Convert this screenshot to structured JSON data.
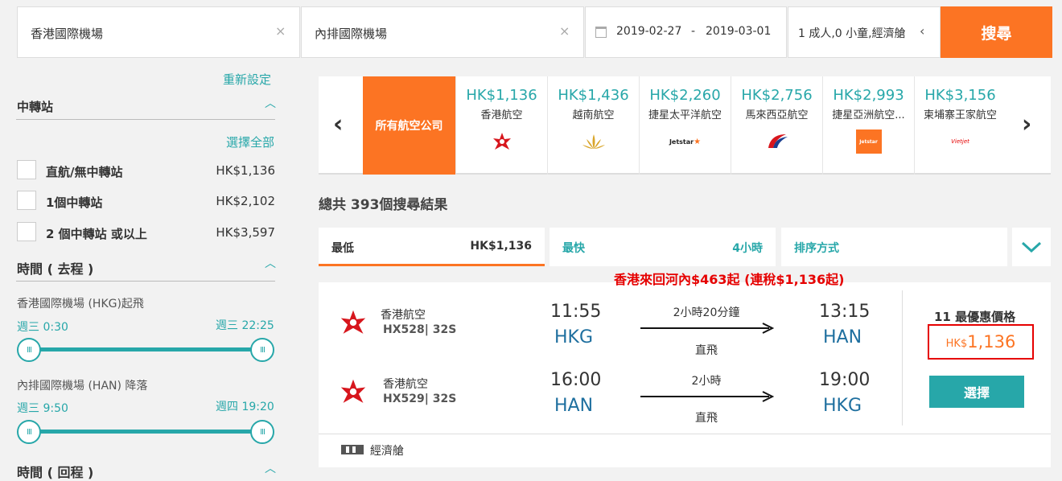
{
  "search": {
    "origin": "香港國際機場",
    "destination": "內排國際機場",
    "depart_date": "2019-02-27",
    "date_separator": "-",
    "return_date": "2019-03-01",
    "passengers": "1 成人,0 小童,經濟艙",
    "search_label": "搜尋"
  },
  "filters": {
    "reset_label": "重新設定",
    "transit_title": "中轉站",
    "select_all": "選擇全部",
    "stops": [
      {
        "label": "直航/無中轉站",
        "price": "HK$1,136"
      },
      {
        "label": "1個中轉站",
        "price": "HK$2,102"
      },
      {
        "label": "2 個中轉站 或以上",
        "price": "HK$3,597"
      }
    ],
    "outbound_title": "時間 ( 去程 )",
    "depart_label": "香港國際機場 (HKG)起飛",
    "depart_min": "週三 0:30",
    "depart_max": "週三 22:25",
    "arrive_label": "內排國際機場 (HAN) 降落",
    "arrive_min": "週三 9:50",
    "arrive_max": "週四 19:20",
    "return_title": "時間 ( 回程 )"
  },
  "airlines": {
    "all_label": "所有航空公司",
    "items": [
      {
        "price": "HK$1,136",
        "name": "香港航空"
      },
      {
        "price": "HK$1,436",
        "name": "越南航空"
      },
      {
        "price": "HK$2,260",
        "name": "捷星太平洋航空",
        "logo_text": "Jetstar"
      },
      {
        "price": "HK$2,756",
        "name": "馬來西亞航空"
      },
      {
        "price": "HK$2,993",
        "name": "捷星亞洲航空...",
        "logo_text": "Jetstar"
      },
      {
        "price": "HK$3,156",
        "name": "柬埔寨王家航空",
        "logo_text": "Vietjet"
      }
    ]
  },
  "results": {
    "total": "總共 393個搜尋結果",
    "sort_tabs": [
      {
        "label": "最低",
        "value": "HK$1,136"
      },
      {
        "label": "最快",
        "value": "4小時"
      },
      {
        "label": "排序方式",
        "value": ""
      }
    ],
    "promo": "香港來回河內$463起 (連稅$1,136起)",
    "outbound": {
      "airline": "香港航空",
      "code": "HX528| 32S",
      "dep_time": "11:55",
      "dep_code": "HKG",
      "duration": "2小時20分鐘",
      "stops": "直飛",
      "arr_time": "13:15",
      "arr_code": "HAN"
    },
    "inbound": {
      "airline": "香港航空",
      "code": "HX529| 32S",
      "dep_time": "16:00",
      "dep_code": "HAN",
      "duration": "2小時",
      "stops": "直飛",
      "arr_time": "19:00",
      "arr_code": "HKG"
    },
    "best_label": "11 最優惠價格",
    "currency": "HK$",
    "price": "1,136",
    "select_label": "選擇",
    "cabin": "經濟艙"
  },
  "colors": {
    "accent": "#27a7a9",
    "orange": "#fc7423",
    "red": "#e60000"
  }
}
